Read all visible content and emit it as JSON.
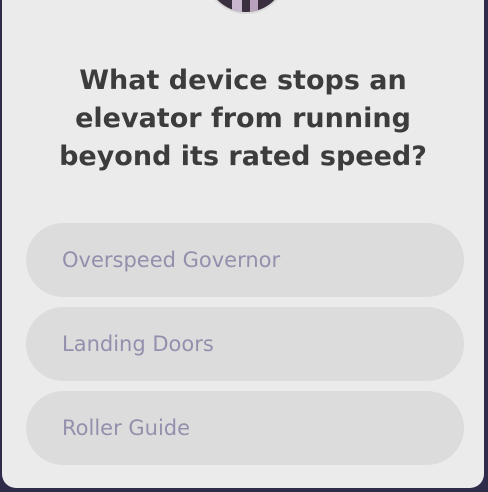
{
  "quiz": {
    "question": "What device stops an elevator from running beyond its rated speed?",
    "answers": [
      {
        "label": "Overspeed Governor"
      },
      {
        "label": "Landing Doors"
      },
      {
        "label": "Roller Guide"
      }
    ]
  },
  "colors": {
    "card_background": "#ebebeb",
    "answer_background": "#dcdcdc",
    "answer_text": "#9390ad",
    "question_text": "#3c3c3c",
    "page_background": "#2f2b4a"
  }
}
